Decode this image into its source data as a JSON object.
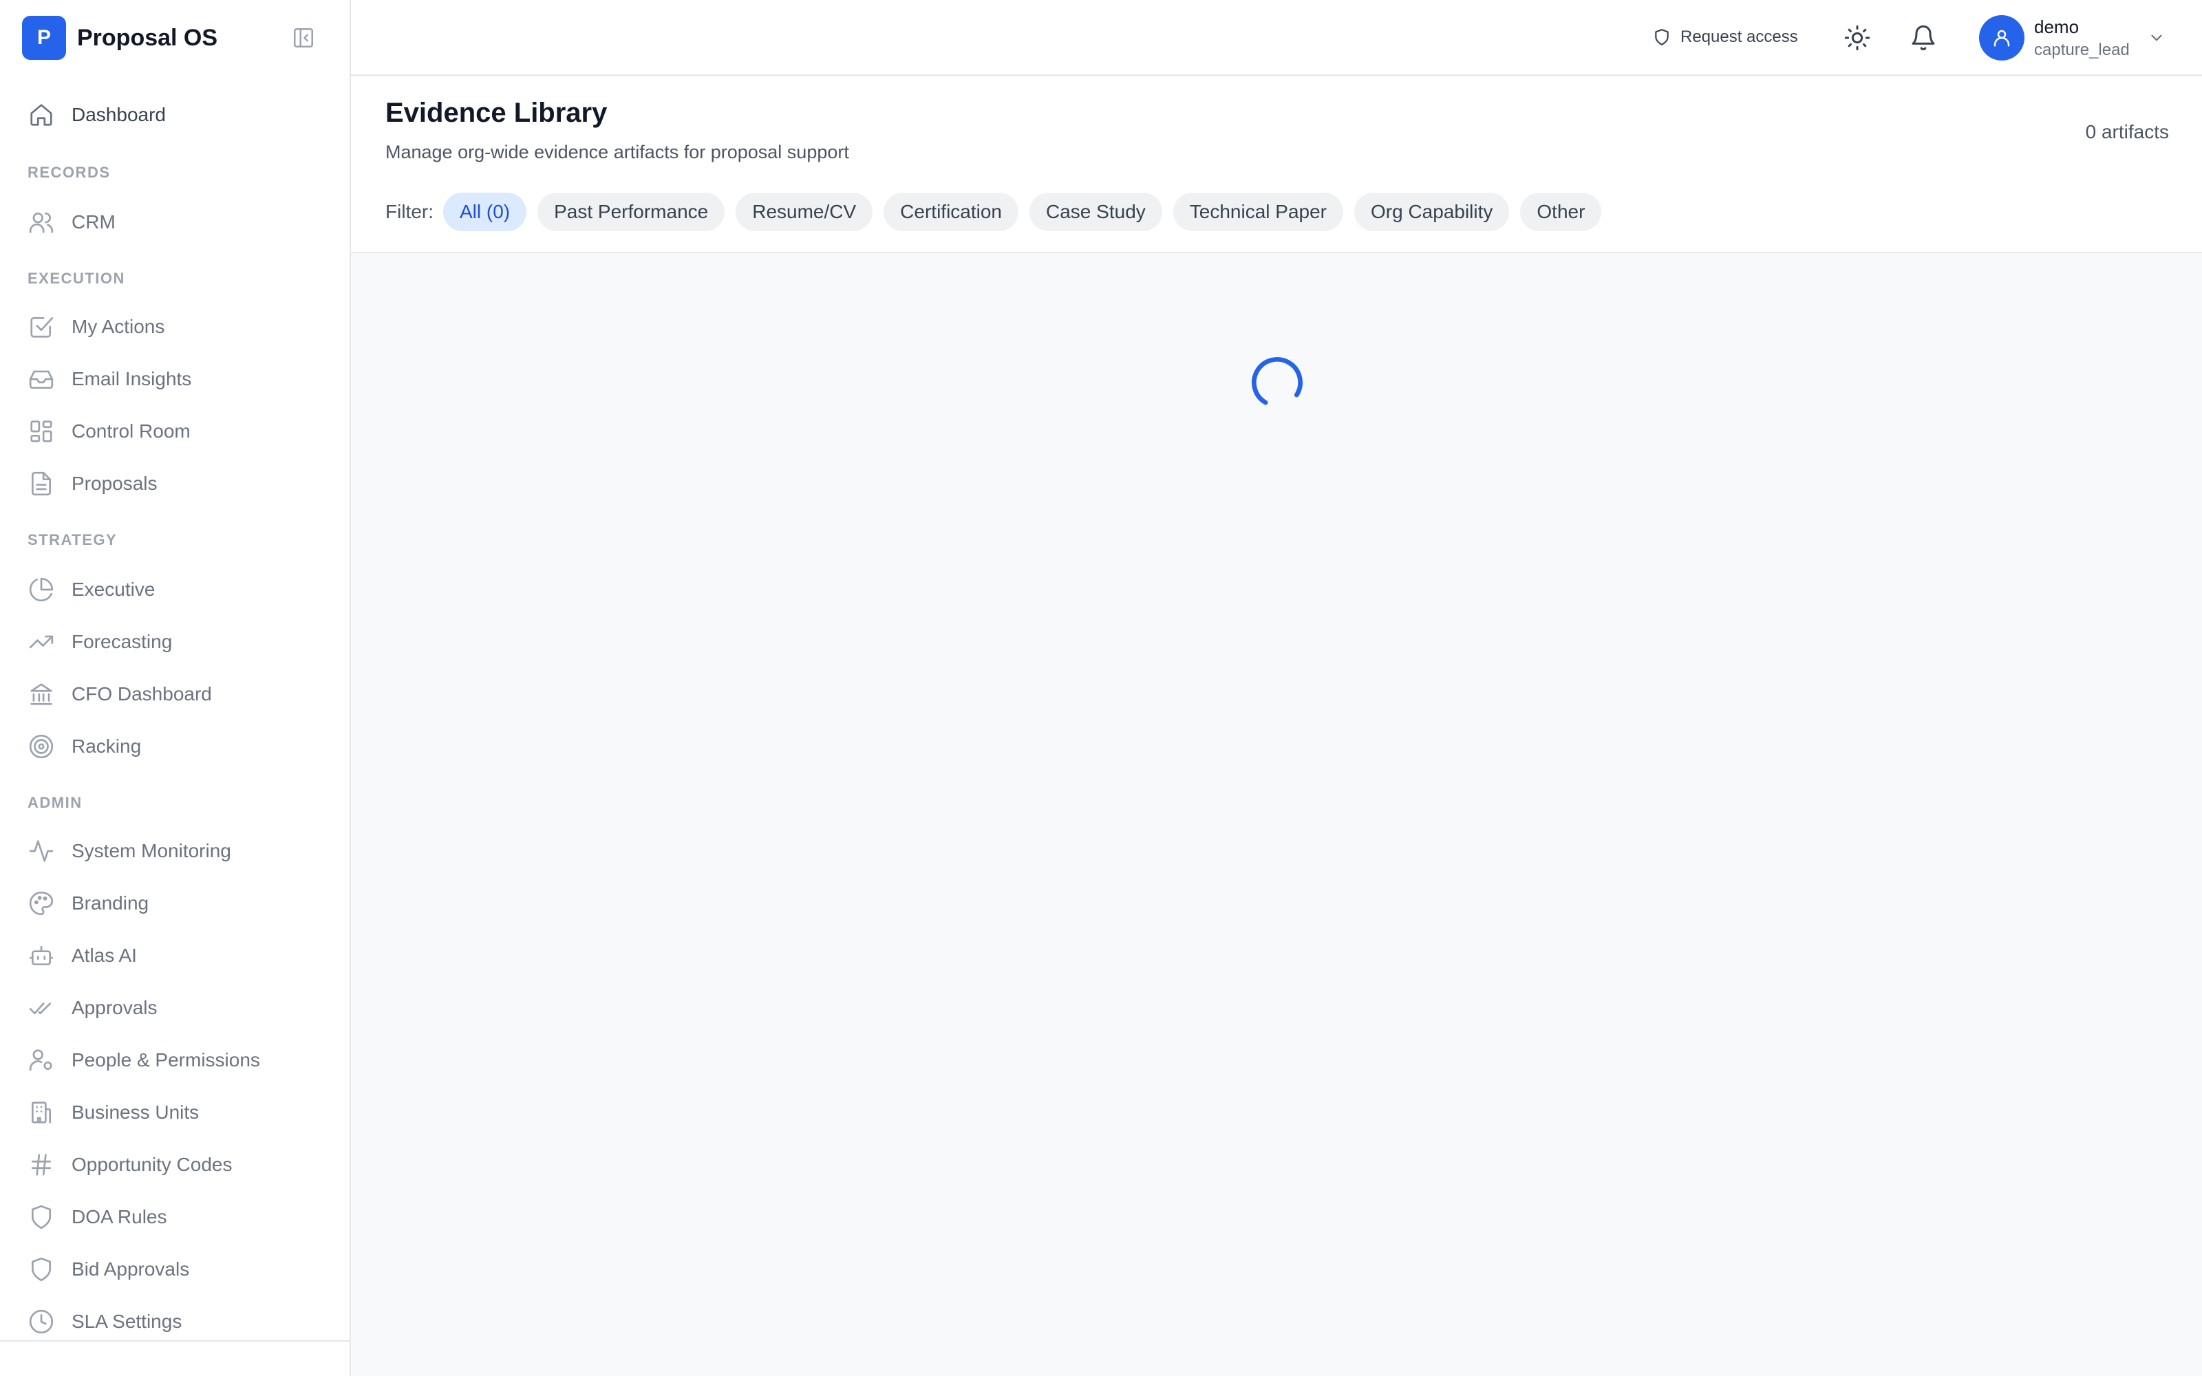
{
  "brand": {
    "logo_letter": "P",
    "name": "Proposal OS"
  },
  "sidebar": {
    "dashboard": "Dashboard",
    "sections": {
      "records": "RECORDS",
      "execution": "EXECUTION",
      "strategy": "STRATEGY",
      "admin": "ADMIN"
    },
    "items": [
      {
        "label": "CRM",
        "icon": "users-icon"
      },
      {
        "label": "My Actions",
        "icon": "check-square-icon"
      },
      {
        "label": "Email Insights",
        "icon": "inbox-icon"
      },
      {
        "label": "Control Room",
        "icon": "layout-grid-icon"
      },
      {
        "label": "Proposals",
        "icon": "document-icon"
      },
      {
        "label": "Executive",
        "icon": "pie-chart-icon"
      },
      {
        "label": "Forecasting",
        "icon": "trending-up-icon"
      },
      {
        "label": "CFO Dashboard",
        "icon": "bank-icon"
      },
      {
        "label": "Racking",
        "icon": "target-icon"
      },
      {
        "label": "System Monitoring",
        "icon": "activity-icon"
      },
      {
        "label": "Branding",
        "icon": "palette-icon"
      },
      {
        "label": "Atlas AI",
        "icon": "bot-icon"
      },
      {
        "label": "Approvals",
        "icon": "double-check-icon"
      },
      {
        "label": "People & Permissions",
        "icon": "user-cog-icon"
      },
      {
        "label": "Business Units",
        "icon": "building-icon"
      },
      {
        "label": "Opportunity Codes",
        "icon": "hash-icon"
      },
      {
        "label": "DOA Rules",
        "icon": "shield-icon"
      },
      {
        "label": "Bid Approvals",
        "icon": "shield-icon"
      },
      {
        "label": "SLA Settings",
        "icon": "clock-icon"
      }
    ]
  },
  "topbar": {
    "request_access": "Request access",
    "user": {
      "name": "demo",
      "role": "capture_lead"
    }
  },
  "page": {
    "title": "Evidence Library",
    "subtitle": "Manage org-wide evidence artifacts for proposal support",
    "count": "0 artifacts",
    "filter_label": "Filter:",
    "filters": [
      "All (0)",
      "Past Performance",
      "Resume/CV",
      "Certification",
      "Case Study",
      "Technical Paper",
      "Org Capability",
      "Other"
    ],
    "active_filter": "All (0)"
  },
  "colors": {
    "accent": "#2563eb",
    "chip_active_bg": "#dbeafe",
    "chip_active_text": "#1d4ed8"
  }
}
